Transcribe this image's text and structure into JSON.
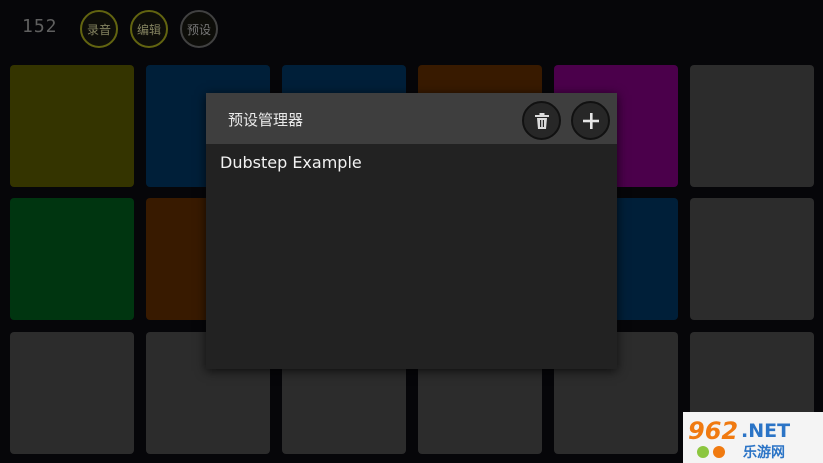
{
  "topbar": {
    "bpm": "152",
    "record_label": "录音",
    "edit_label": "编辑",
    "preset_label": "预设"
  },
  "pads": [
    {
      "color": "#545400"
    },
    {
      "color": "#01335d"
    },
    {
      "color": "#01335d"
    },
    {
      "color": "#5b2b00"
    },
    {
      "color": "#7a007a"
    },
    {
      "color": "#474747"
    },
    {
      "color": "#00561a"
    },
    {
      "color": "#5b2b00"
    },
    {
      "color": "#474747"
    },
    {
      "color": "#474747"
    },
    {
      "color": "#01335d"
    },
    {
      "color": "#474747"
    },
    {
      "color": "#474747"
    },
    {
      "color": "#474747"
    },
    {
      "color": "#474747"
    },
    {
      "color": "#474747"
    },
    {
      "color": "#474747"
    },
    {
      "color": "#474747"
    }
  ],
  "dialog": {
    "title": "预设管理器",
    "delete_icon": "trash-icon",
    "add_icon": "plus-icon",
    "presets": [
      "Dubstep Example"
    ]
  },
  "watermark": {
    "logo_text": "962.NET",
    "sub_text": "乐游网"
  }
}
